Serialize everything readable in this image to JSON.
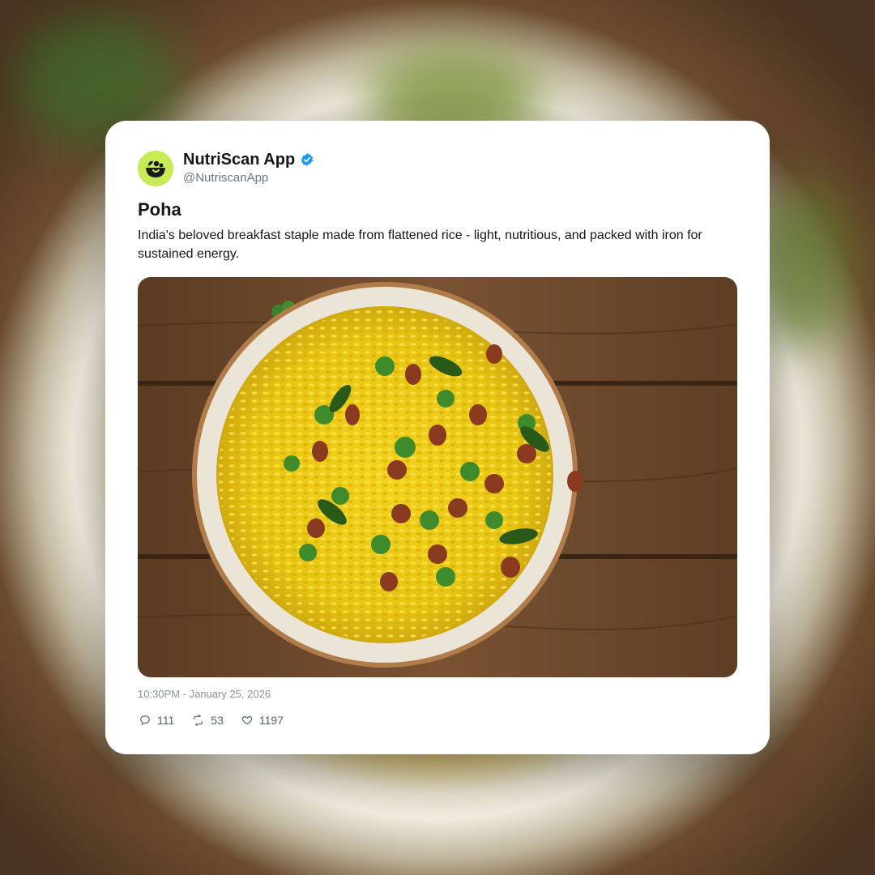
{
  "post": {
    "author": {
      "display_name": "NutriScan App",
      "handle": "@NutriscanApp",
      "verified": true,
      "avatar_color": "#c8ec55"
    },
    "title": "Poha",
    "description": "India's beloved breakfast staple made from flattened rice - light, nutritious, and packed with iron for sustained energy.",
    "image_alt": "Bowl of poha topped with peanuts, curry leaves and cilantro on a wooden table",
    "timestamp": "10:30PM - January 25, 2026",
    "stats": {
      "replies": "111",
      "reposts": "53",
      "likes": "1197"
    }
  },
  "icons": {
    "verified": "verified-badge-icon",
    "reply": "reply-icon",
    "repost": "repost-icon",
    "like": "heart-icon"
  },
  "colors": {
    "verified_blue": "#1d9bf0",
    "text_primary": "#14171a",
    "text_secondary": "#6e767d"
  }
}
